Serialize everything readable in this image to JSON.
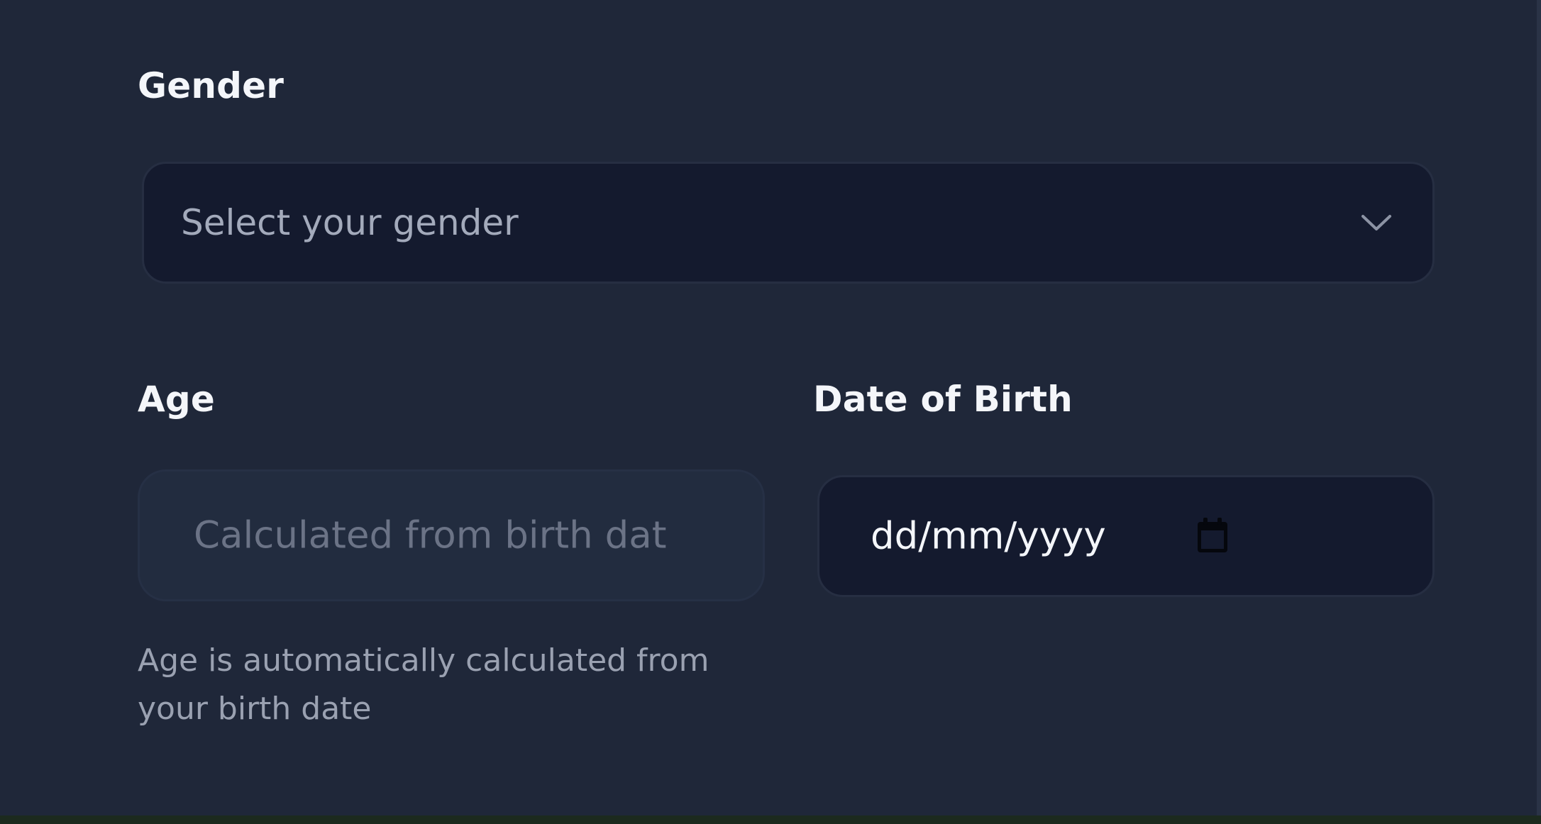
{
  "form": {
    "gender": {
      "label": "Gender",
      "placeholder": "Select your gender",
      "icon": "chevron-down-icon"
    },
    "age": {
      "label": "Age",
      "placeholder": "Calculated from birth date",
      "help": "Age is automatically calculated from your birth date",
      "disabled": true
    },
    "dob": {
      "label": "Date of Birth",
      "value": "dd/mm/yyyy",
      "icon": "calendar-icon"
    }
  },
  "colors": {
    "background": "#1f2739",
    "input_background": "#141a2e",
    "disabled_input_background": "#222c3f",
    "label_text": "#f4f6fa",
    "muted_text": "#9aa1b1"
  }
}
